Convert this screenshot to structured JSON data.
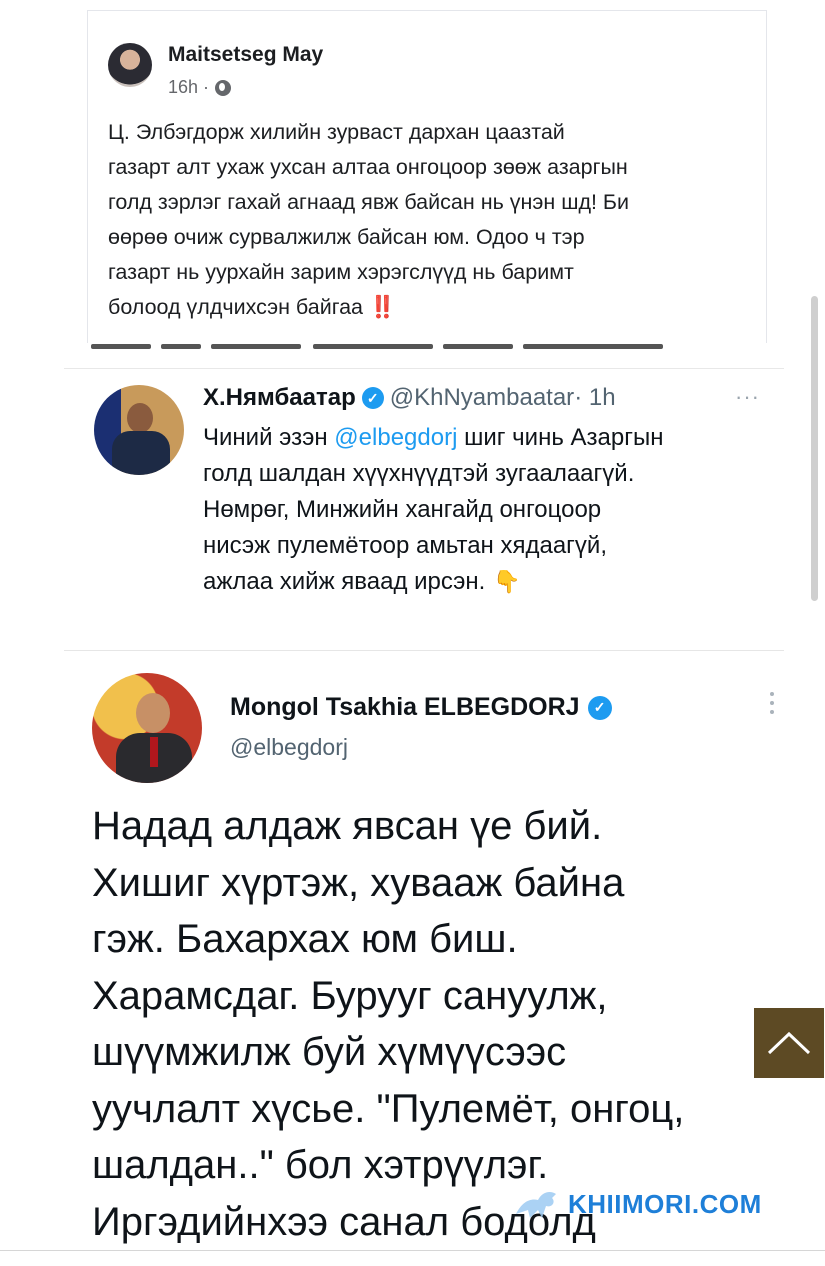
{
  "facebook_post": {
    "author": "Maitsetseg May",
    "meta": "16h ·",
    "privacy_icon": "globe-icon",
    "text_lines": [
      "Ц. Элбэгдорж хилийн зурваст дархан цаазтай",
      "газарт алт ухаж ухсан алтаа онгоцоор зөөж азаргын",
      "голд зэрлэг гахай агнаад явж байсан нь үнэн шд! Би",
      "өөрөө очиж сурвалжилж байсан юм. Одоо ч тэр",
      "газарт нь уурхайн зарим хэрэгслүүд нь баримт",
      "болоод үлдчихсэн байгаа"
    ],
    "alarm_emoji": "‼️"
  },
  "tweet_nyambaatar": {
    "name": "Х.Нямбаатар",
    "handle": "@KhNyambaatar",
    "time": "· 1h",
    "more": "···",
    "lines": [
      {
        "pre": "Чиний эзэн ",
        "mention": "@elbegdorj",
        "post": " шиг чинь Азаргын"
      },
      {
        "pre": "голд шалдан хүүхнүүдтэй зугаалаагүй.",
        "mention": "",
        "post": ""
      },
      {
        "pre": "Нөмрөг, Минжийн хангайд онгоцоор",
        "mention": "",
        "post": ""
      },
      {
        "pre": "нисэж пулемётоор амьтан хядаагүй,",
        "mention": "",
        "post": ""
      },
      {
        "pre": "ажлаа хийж яваад ирсэн.",
        "mention": "",
        "post": ""
      }
    ],
    "emoji": "👇"
  },
  "tweet_elbegdorj": {
    "name": "Mongol Tsakhia ELBEGDORJ",
    "handle": "@elbegdorj",
    "lines": [
      "Надад алдаж явсан үе бий.",
      "Хишиг хүртэж, хувааж байна",
      "гэж. Бахархах юм биш.",
      "Харамсдаг. Бурууг сануулж,",
      "шүүмжилж буй хүмүүсээс",
      "уучлалт хүсье. \"Пулемёт, онгоц,",
      "шалдан..\" бол хэтрүүлэг.",
      "Иргэдийнхээ санал бодолд"
    ]
  },
  "watermark": "KHIIMORI.COM",
  "scroll_top_icon": "chevron-up-icon",
  "colors": {
    "mention": "#1d9bf0",
    "verified": "#1d9bf0",
    "scroll_button": "#5d4a24",
    "watermark": "#1e7fd8"
  }
}
